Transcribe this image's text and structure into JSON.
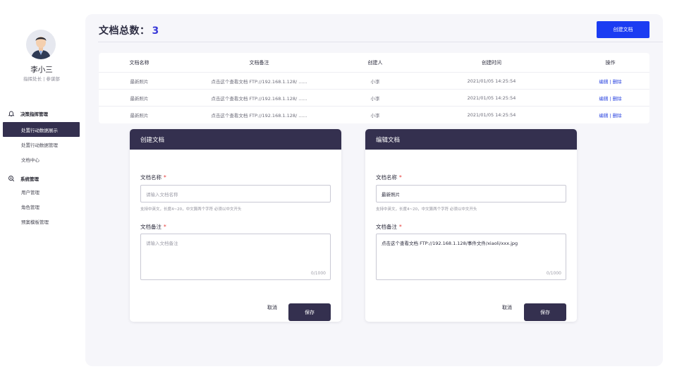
{
  "user": {
    "name": "李小三",
    "role": "指挥处长 | 参谋部"
  },
  "sidebar": {
    "groups": [
      {
        "title": "决策指挥管理",
        "icon": "bell-icon",
        "items": [
          {
            "label": "处置行动数据展示"
          },
          {
            "label": "处置行动数据管理"
          },
          {
            "label": "文档中心"
          }
        ]
      },
      {
        "title": "系统管理",
        "icon": "settings-search-icon",
        "items": [
          {
            "label": "用户管理"
          },
          {
            "label": "角色管理"
          },
          {
            "label": "预案模板管理"
          }
        ]
      }
    ]
  },
  "header": {
    "title": "文档总数：",
    "count": "3",
    "create_button": "创建文档"
  },
  "table": {
    "columns": [
      "文档名称",
      "文档备注",
      "创建人",
      "创建时间",
      "操作"
    ],
    "rows": [
      {
        "name": "最新照片",
        "note": "点击这个查看文档  FTP://192.168.1.128/ ......",
        "creator": "小李",
        "time": "2021/01/05 14:25:54",
        "edit": "编辑",
        "sep": "|",
        "delete": "删除"
      },
      {
        "name": "最新照片",
        "note": "点击这个查看文档  FTP://192.168.1.128/ ......",
        "creator": "小李",
        "time": "2021/01/05 14:25:54",
        "edit": "编辑",
        "sep": "|",
        "delete": "删除"
      },
      {
        "name": "最新照片",
        "note": "点击这个查看文档  FTP://192.168.1.128/ ......",
        "creator": "小李",
        "time": "2021/01/05 14:25:54",
        "edit": "编辑",
        "sep": "|",
        "delete": "删除"
      }
    ]
  },
  "create_form": {
    "title": "创建文档",
    "name_label": "文档名称",
    "required_mark": "*",
    "name_placeholder": "请输入文档名称",
    "name_hint": "支持中英文，长度4~20，中文算两个字符 必须以中文开头",
    "note_label": "文档备注",
    "note_placeholder": "请输入文档备注",
    "note_counter": "0/1000",
    "cancel": "取消",
    "save": "保存"
  },
  "edit_form": {
    "title": "编辑文档",
    "name_label": "文档名称",
    "required_mark": "*",
    "name_value": "最新照片",
    "name_hint": "支持中英文，长度4~20，中文算两个字符 必须以中文开头",
    "note_label": "文档备注",
    "note_value": "点击这个查看文档  FTP://192.168.1.128/事件文件/xiaoli/xxx.jpg",
    "note_counter": "0/1000",
    "cancel": "取消",
    "save": "保存"
  }
}
